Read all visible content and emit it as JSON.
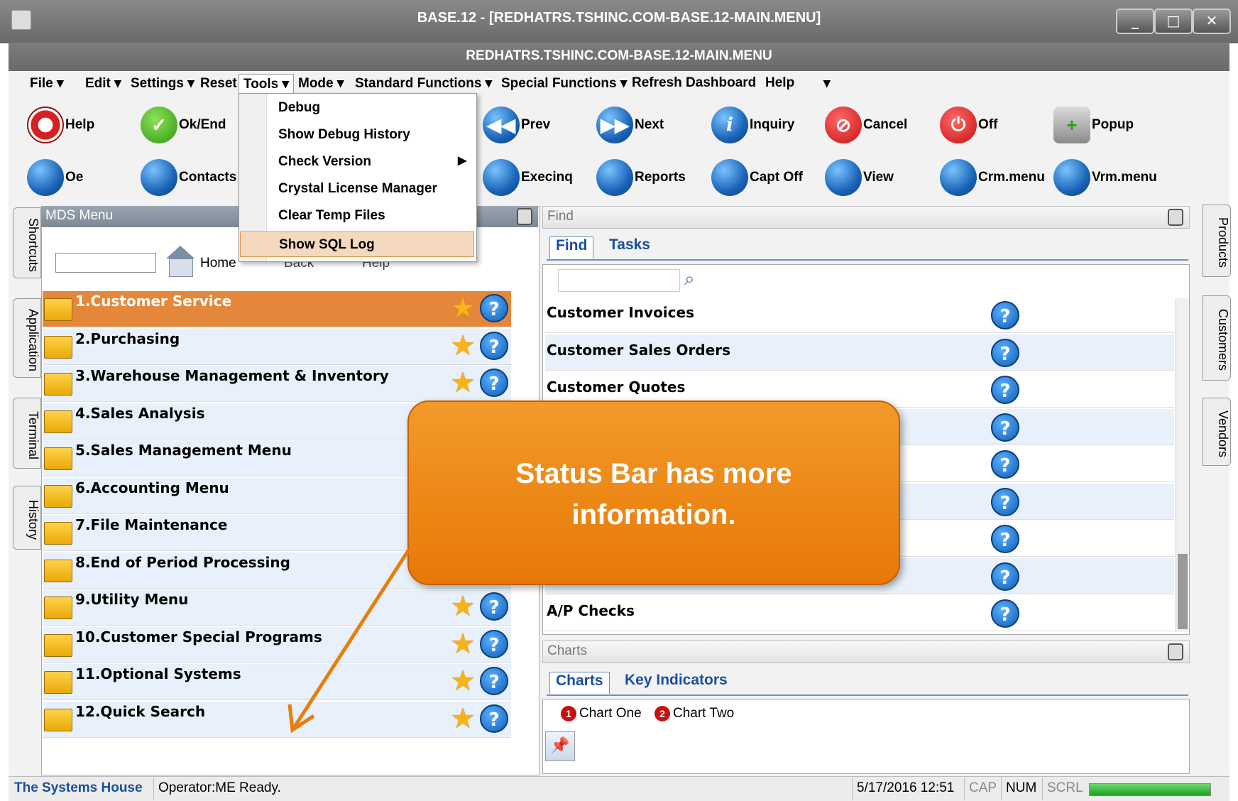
{
  "window": {
    "title": "BASE.12 - [REDHATRS.TSHINC.COM-BASE.12-MAIN.MENU]",
    "subtitle": "REDHATRS.TSHINC.COM-BASE.12-MAIN.MENU",
    "btn_min": "_",
    "btn_max": "□",
    "btn_close": "✕"
  },
  "menubar": {
    "file": "File ▾",
    "edit": "Edit ▾",
    "settings": "Settings ▾",
    "reset": "Reset ▾",
    "tools": "Tools ▾",
    "mode": "Mode ▾",
    "standard": "Standard Functions ▾",
    "special": "Special Functions ▾",
    "refresh": "Refresh Dashboard",
    "help": "Help",
    "overflow": "▾"
  },
  "tools_menu": [
    "Debug",
    "Show Debug History",
    "Check Version",
    "Crystal License Manager",
    "Clear Temp Files",
    "Show SQL Log"
  ],
  "toolbar1": {
    "help": "Help",
    "okend": "Ok/End",
    "prev": "Prev",
    "next": "Next",
    "inquiry": "Inquiry",
    "cancel": "Cancel",
    "off": "Off",
    "popup": "Popup"
  },
  "toolbar2": {
    "oe": "Oe",
    "contacts": "Contacts",
    "execinq": "Execinq",
    "reports": "Reports",
    "captoff": "Capt Off",
    "view": "View",
    "crm": "Crm.menu",
    "vrm": "Vrm.menu"
  },
  "left_tabs": [
    "Shortcuts",
    "Application",
    "Terminal",
    "History"
  ],
  "right_tabs": [
    "Products",
    "Customers",
    "Vendors"
  ],
  "mds": {
    "header": "MDS Menu",
    "home": "Home",
    "back": "Back",
    "help": "Help",
    "items": [
      "1.Customer Service",
      "2.Purchasing",
      "3.Warehouse Management & Inventory",
      "4.Sales Analysis",
      "5.Sales Management Menu",
      "6.Accounting Menu",
      "7.File Maintenance",
      "8.End of Period Processing",
      "9.Utility Menu",
      "10.Customer Special Programs",
      "11.Optional Systems",
      "12.Quick Search"
    ]
  },
  "find": {
    "header": "Find",
    "tab_find": "Find",
    "tab_tasks": "Tasks",
    "rows": [
      "Customer Invoices",
      "Customer Sales Orders",
      "Customer Quotes",
      "",
      "",
      "",
      "",
      "",
      "A/P Checks"
    ]
  },
  "charts": {
    "header": "Charts",
    "tab_charts": "Charts",
    "tab_key": "Key Indicators",
    "chart_one": "Chart One",
    "chart_two": "Chart Two",
    "badge_one": "1",
    "badge_two": "2"
  },
  "callout": {
    "text": "Status Bar has more information."
  },
  "statusbar": {
    "company": "The Systems House",
    "operator": "Operator:ME Ready.",
    "datetime": "5/17/2016 12:51",
    "cap": "CAP",
    "num": "NUM",
    "scrl": "SCRL",
    "progress": 1.0
  },
  "colors": {
    "callout": "#f0840a",
    "selected_row": "#e5873a",
    "accent_blue": "#1a4f9a"
  }
}
